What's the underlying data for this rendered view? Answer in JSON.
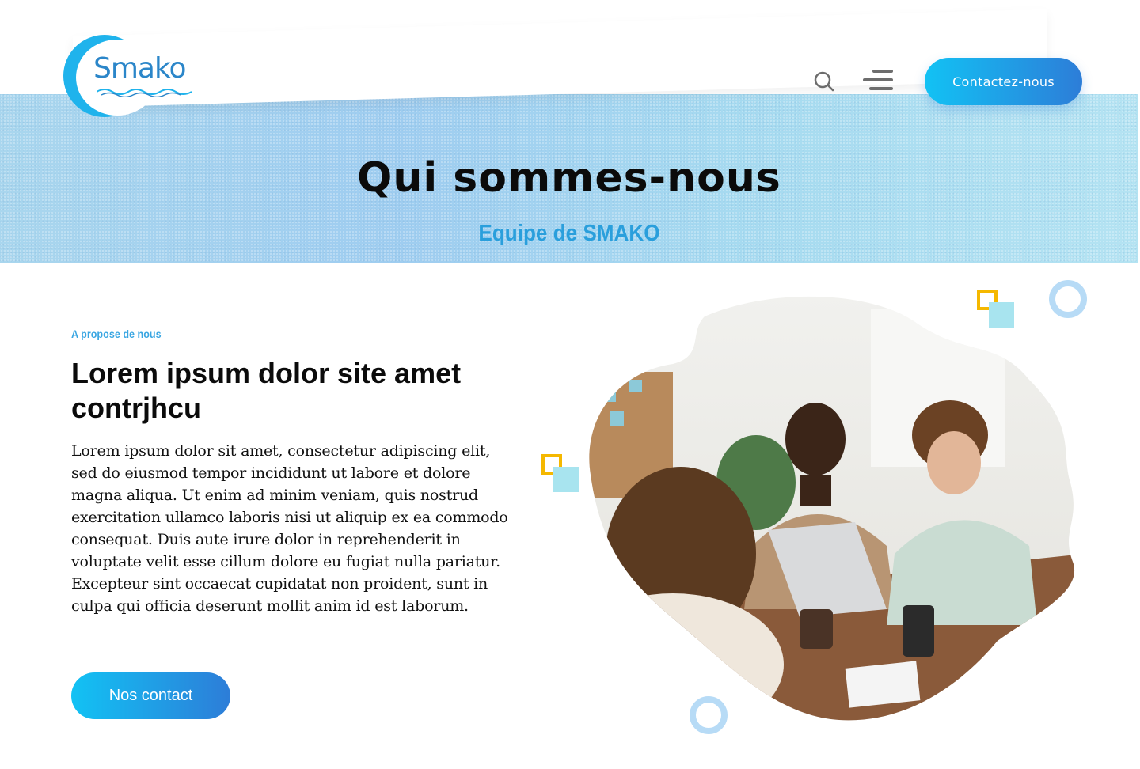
{
  "header": {
    "logo_text": "Smako",
    "contact_button": "Contactez-nous",
    "icons": {
      "search": "search-icon",
      "menu": "menu-icon"
    }
  },
  "hero": {
    "title": "Qui sommes-nous",
    "subtitle": "Equipe de SMAKO"
  },
  "about": {
    "kicker": "A propose de nous",
    "title": "Lorem ipsum dolor site amet contrjhcu",
    "body": "Lorem ipsum dolor sit amet, consectetur adipiscing elit, sed do eiusmod tempor incididunt ut labore et dolore magna aliqua. Ut enim ad minim veniam, quis nostrud exercitation ullamco laboris nisi ut aliquip ex ea commodo consequat. Duis aute irure dolor in reprehenderit in voluptate velit esse cillum dolore eu fugiat nulla pariatur. Excepteur sint occaecat cupidatat non proident, sunt in culpa qui officia deserunt mollit anim id est laborum.",
    "button": "Nos contact"
  },
  "colors": {
    "accent_start": "#12c2f4",
    "accent_end": "#2d7dd8",
    "subtitle": "#2a9fdc",
    "deco_yellow": "#f5b800",
    "deco_cyan": "#a8e4ef",
    "deco_ring": "#b7dbf6"
  }
}
